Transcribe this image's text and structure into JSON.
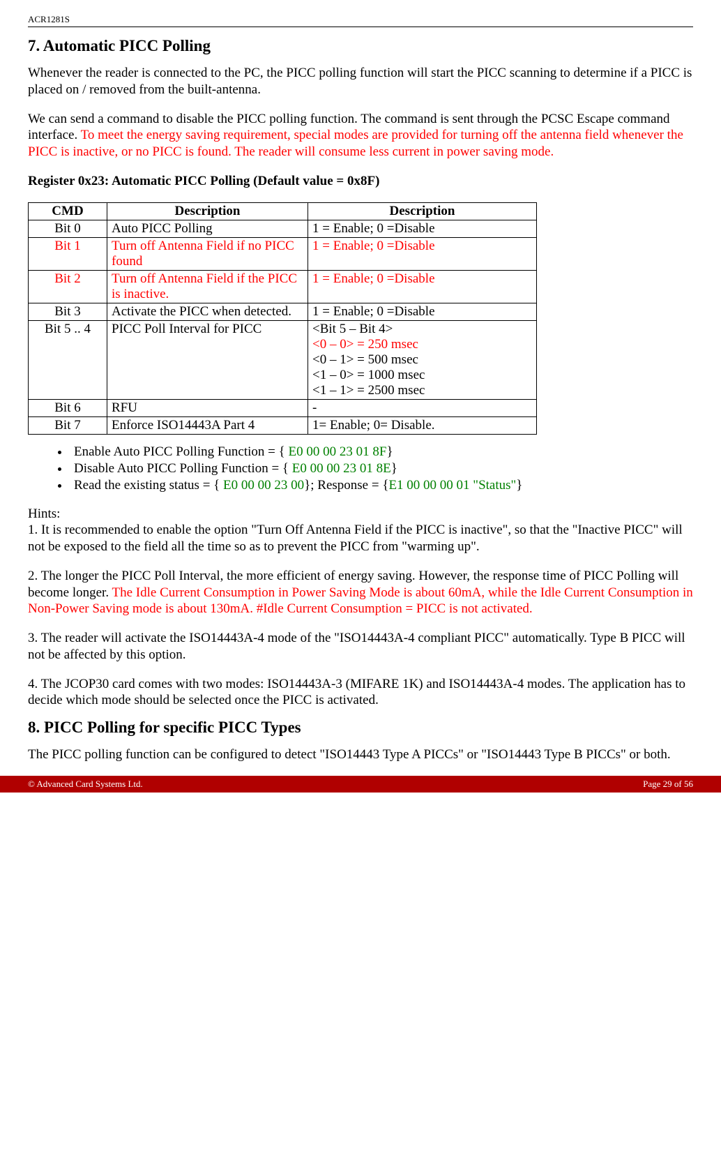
{
  "header": {
    "code": "ACR1281S"
  },
  "section7": {
    "title": "7. Automatic PICC Polling",
    "p1": "Whenever the reader is connected to the PC, the PICC polling function will start the PICC scanning to determine if a PICC is placed on / removed from the built-antenna.",
    "p2a": "We can send a command to disable the PICC polling function. The command is sent through the PCSC Escape command interface. ",
    "p2b": "To meet the energy saving requirement, special modes are provided for turning off the antenna field whenever the PICC is inactive, or no PICC is found. The reader will consume less current in power saving mode.",
    "reg_title": "Register 0x23: Automatic PICC Polling (Default value = 0x8F)",
    "table": {
      "h1": "CMD",
      "h2": "Description",
      "h3": "Description",
      "rows": [
        {
          "c1": "Bit 0",
          "c2": "Auto PICC Polling",
          "c3": "1 = Enable; 0 =Disable",
          "red": false
        },
        {
          "c1": "Bit 1",
          "c2": "Turn off Antenna Field if no PICC found",
          "c3": "1 = Enable; 0 =Disable",
          "red": true
        },
        {
          "c1": "Bit 2",
          "c2": "Turn off Antenna Field if the PICC is inactive.",
          "c3": "1 = Enable; 0 =Disable",
          "red": true
        },
        {
          "c1": "Bit 3",
          "c2": "Activate the PICC when detected.",
          "c3": "1 = Enable; 0 =Disable",
          "red": false
        }
      ],
      "row5": {
        "c1": "Bit 5 .. 4",
        "c2": "PICC Poll Interval for PICC",
        "l1": "<Bit 5 – Bit 4>",
        "l2": "<0 – 0> = 250 msec",
        "l3": "<0 – 1> = 500 msec",
        "l4": "<1 – 0> = 1000 msec",
        "l5": "<1 – 1> = 2500 msec"
      },
      "row6": {
        "c1": "Bit 6",
        "c2": "RFU",
        "c3": "-"
      },
      "row7": {
        "c1": "Bit 7",
        "c2": "Enforce ISO14443A Part 4",
        "c3": "1= Enable; 0= Disable."
      }
    },
    "bullets": {
      "b1a": "Enable Auto PICC Polling Function = { ",
      "b1b": "E0 00 00 23 01 8F",
      "b1c": "}",
      "b2a": "Disable Auto PICC Polling Function = { ",
      "b2b": "E0 00 00 23 01 8E",
      "b2c": "}",
      "b3a": "Read the existing status = { ",
      "b3b": "E0 00 00 23 00",
      "b3c": "}; Response = {",
      "b3d": "E1 00 00 00 01 \"Status\"",
      "b3e": "}"
    },
    "hints_label": "Hints:",
    "hint1": "1. It is recommended to enable the option \"Turn Off Antenna Field if the PICC is inactive\", so that the \"Inactive PICC\" will not be exposed to the field all the time so as to prevent the PICC from \"warming up\".",
    "hint2a": "2. The longer the PICC Poll Interval, the more efficient of energy saving. However, the response time of PICC Polling will become longer. ",
    "hint2b": "The Idle Current Consumption in Power Saving Mode is about 60mA, while the Idle Current Consumption in Non-Power Saving mode is about 130mA. #Idle Current Consumption = PICC is not activated.",
    "hint3": "3. The reader will activate the ISO14443A-4 mode of the \"ISO14443A-4 compliant PICC\" automatically. Type B PICC will not be affected by this option.",
    "hint4": "4. The JCOP30 card comes with two modes: ISO14443A-3 (MIFARE 1K) and ISO14443A-4 modes. The application has to decide which mode should be selected once the PICC is activated."
  },
  "section8": {
    "title": "8. PICC Polling for specific PICC Types",
    "p1": "The PICC polling function can be configured to detect \"ISO14443 Type A PICCs\" or \"ISO14443 Type B PICCs\" or both."
  },
  "footer": {
    "left": "© Advanced Card Systems Ltd.",
    "right": "Page 29 of 56"
  }
}
